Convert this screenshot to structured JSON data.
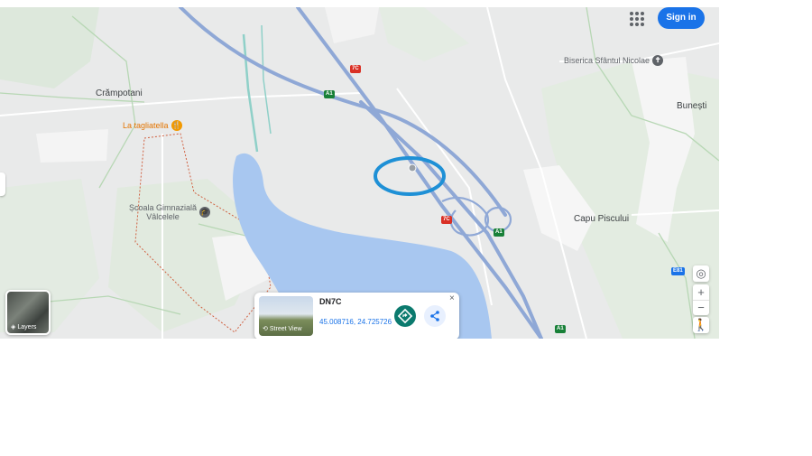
{
  "header": {
    "sign_in_label": "Sign in",
    "apps_icon": "grid-icon"
  },
  "places": {
    "crampotani": "Crămpotani",
    "bunesti": "Bunești",
    "capu_piscului": "Capu Piscului",
    "biserica": "Biserica Sfântul Nicolae",
    "la_tagliatella": "La tagliatella",
    "scoala_line1": "Școala Gimnazială",
    "scoala_line2": "Vâlcelele"
  },
  "road_shields": {
    "a1_top": "A1",
    "a1_mid": "A1",
    "a1_bottom": "A1",
    "dn7c_top": "7C",
    "dn7c_mid": "7C",
    "e81": "E81"
  },
  "layers_button": {
    "label": "Layers"
  },
  "map_controls": {
    "zoom_in": "+",
    "zoom_out": "−"
  },
  "info_card": {
    "title": "DN7C",
    "coordinates": "45.008716, 24.725726",
    "street_view_label": "Street View",
    "close": "×"
  },
  "colors": {
    "accent": "#1a73e8",
    "highlight_ring": "#1e90d6",
    "water": "#a8c7f0",
    "motorway": "#8fa8d6"
  }
}
